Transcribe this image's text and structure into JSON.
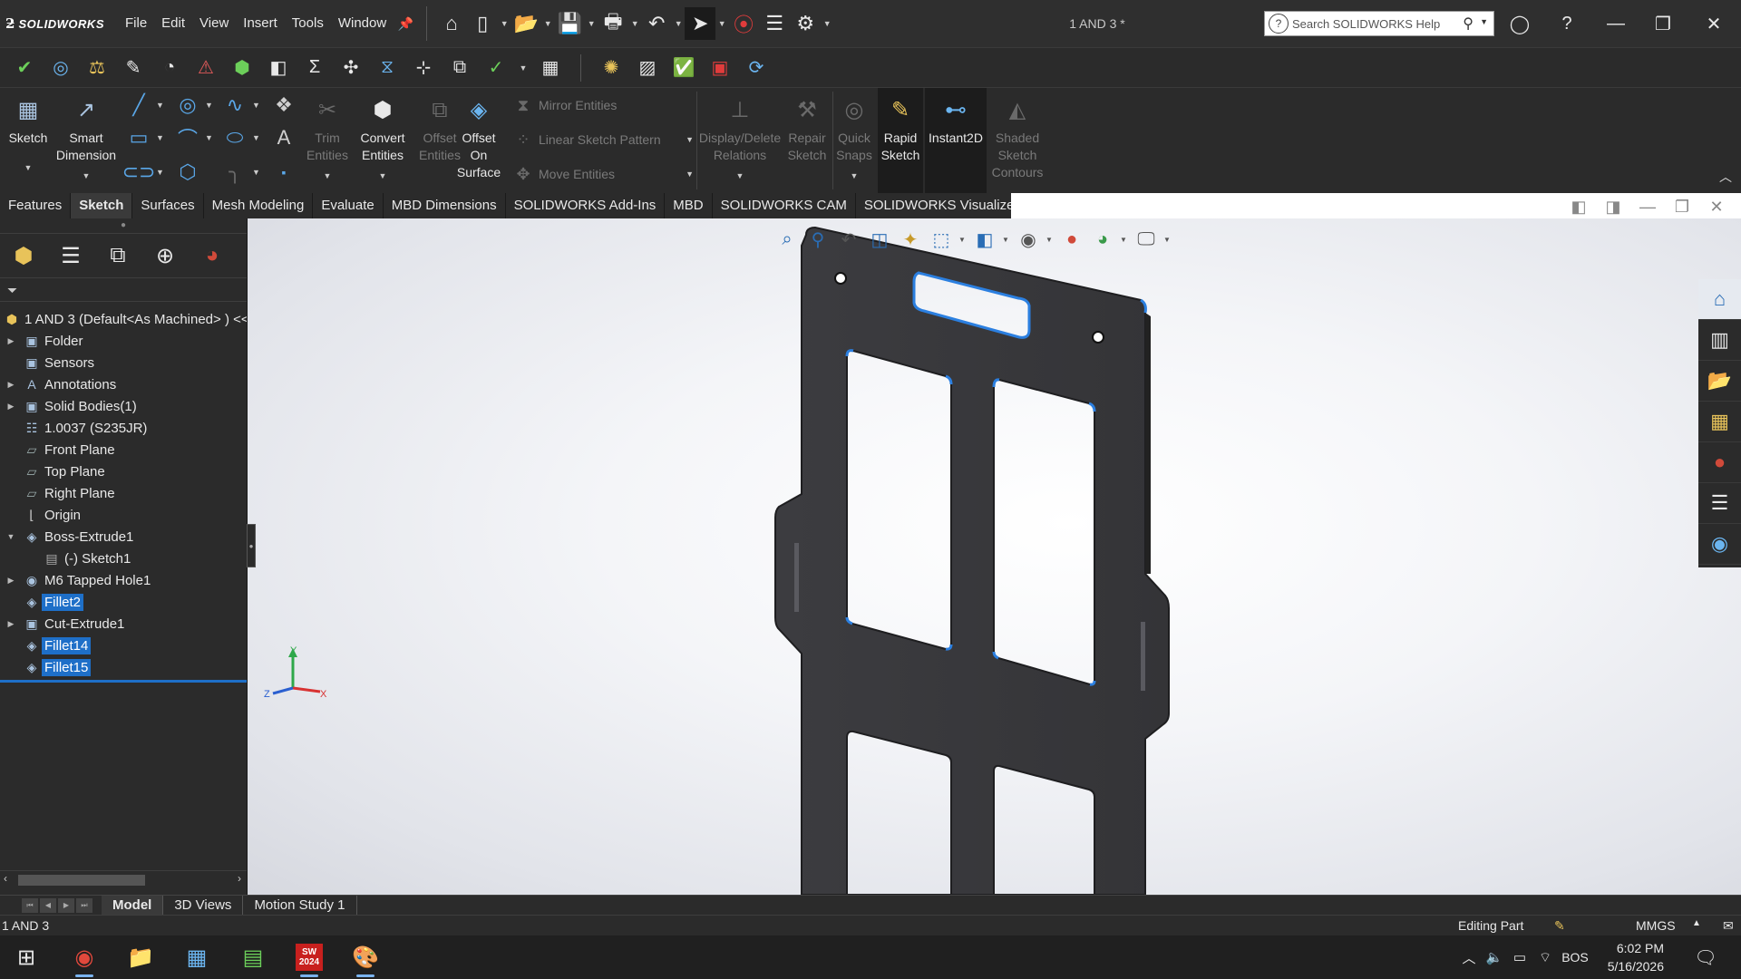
{
  "app": {
    "logo_brand": "SOLIDWORKS",
    "document_title": "1 AND 3 *"
  },
  "menu": [
    "File",
    "Edit",
    "View",
    "Insert",
    "Tools",
    "Window"
  ],
  "search": {
    "placeholder": "Search SOLIDWORKS Help"
  },
  "ribbon": {
    "sketch": "Sketch",
    "smart_dimension": [
      "Smart",
      "Dimension"
    ],
    "trim": [
      "Trim",
      "Entities"
    ],
    "convert": [
      "Convert",
      "Entities"
    ],
    "offset": [
      "Offset",
      "Entities"
    ],
    "offset_surface": [
      "Offset",
      "On",
      "Surface"
    ],
    "mirror": "Mirror Entities",
    "linear_pattern": "Linear Sketch Pattern",
    "move": "Move Entities",
    "display_delete": [
      "Display/Delete",
      "Relations"
    ],
    "repair": [
      "Repair",
      "Sketch"
    ],
    "quick_snaps": [
      "Quick",
      "Snaps"
    ],
    "rapid_sketch": [
      "Rapid",
      "Sketch"
    ],
    "instant2d": "Instant2D",
    "shaded_contours": [
      "Shaded",
      "Sketch",
      "Contours"
    ]
  },
  "tabs": [
    "Features",
    "Sketch",
    "Surfaces",
    "Mesh Modeling",
    "Evaluate",
    "MBD Dimensions",
    "SOLIDWORKS Add-Ins",
    "MBD",
    "SOLIDWORKS CAM",
    "SOLIDWORKS Visualize"
  ],
  "active_tab": "Sketch",
  "tree": {
    "root": "1 AND 3 (Default<As Machined> ) <<",
    "items": [
      {
        "label": "Folder",
        "icon": "folder-icon",
        "expandable": true,
        "indent": 0
      },
      {
        "label": "Sensors",
        "icon": "sensors-icon",
        "expandable": false,
        "indent": 0
      },
      {
        "label": "Annotations",
        "icon": "annotations-icon",
        "expandable": true,
        "indent": 0
      },
      {
        "label": "Solid Bodies(1)",
        "icon": "solid-bodies-icon",
        "expandable": true,
        "indent": 0
      },
      {
        "label": "1.0037 (S235JR)",
        "icon": "material-icon",
        "expandable": false,
        "indent": 0
      },
      {
        "label": "Front Plane",
        "icon": "plane-icon",
        "expandable": false,
        "indent": 0
      },
      {
        "label": "Top Plane",
        "icon": "plane-icon",
        "expandable": false,
        "indent": 0
      },
      {
        "label": "Right Plane",
        "icon": "plane-icon",
        "expandable": false,
        "indent": 0
      },
      {
        "label": "Origin",
        "icon": "origin-icon",
        "expandable": false,
        "indent": 0
      },
      {
        "label": "Boss-Extrude1",
        "icon": "extrude-icon",
        "expandable": true,
        "expanded": true,
        "indent": 0
      },
      {
        "label": "(-) Sketch1",
        "icon": "sketch-icon",
        "expandable": false,
        "indent": 1
      },
      {
        "label": "M6 Tapped Hole1",
        "icon": "hole-icon",
        "expandable": true,
        "indent": 0
      },
      {
        "label": "Fillet2",
        "icon": "fillet-icon",
        "expandable": false,
        "indent": 0,
        "selected": true
      },
      {
        "label": "Cut-Extrude1",
        "icon": "cut-extrude-icon",
        "expandable": true,
        "indent": 0
      },
      {
        "label": "Fillet14",
        "icon": "fillet-icon",
        "expandable": false,
        "indent": 0,
        "selected": true
      },
      {
        "label": "Fillet15",
        "icon": "fillet-icon",
        "expandable": false,
        "indent": 0,
        "selected": true
      }
    ]
  },
  "triad": {
    "x": "X",
    "y": "Y",
    "z": "Z"
  },
  "model_tabs": [
    "Model",
    "3D Views",
    "Motion Study 1"
  ],
  "status": {
    "part_name": "1 AND 3",
    "mode": "Editing Part",
    "units": "MMGS"
  },
  "taskbar": {
    "lang": "BOS",
    "time": "6:02 PM",
    "date": "5/16/2026",
    "sw_badge": "SW 2024"
  },
  "colors": {
    "accent": "#1e6fc8",
    "part_face": "#3a3a3d",
    "edge_highlight": "#2b7fe0"
  }
}
